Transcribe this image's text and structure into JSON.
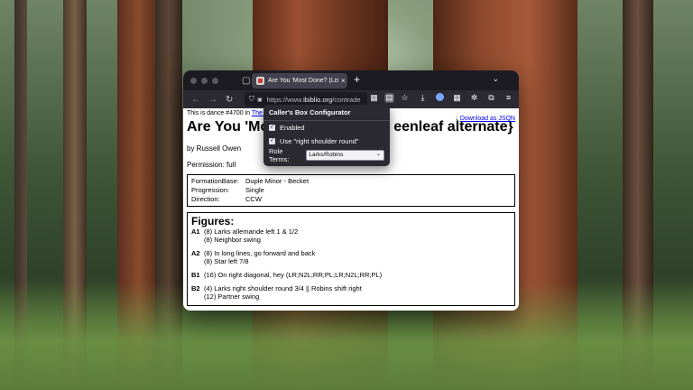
{
  "browser": {
    "tab_title": "Are You 'Most Done? (Lisa Gree",
    "tab_close": "×",
    "new_tab": "+",
    "tab_list": "⌄",
    "url_prefix": "https://www.",
    "url_domain": "ibiblio.org",
    "url_path": "/contrade",
    "icons": {
      "back": "←",
      "forward": "→",
      "reload": "↻",
      "shield": "⛉",
      "lock": "🔒",
      "bookmark": "☆",
      "download": "⤓",
      "extensions": "⧉",
      "menu": "≡"
    }
  },
  "page": {
    "intro_text": "This is dance #4700 in ",
    "intro_link": "The C",
    "download_arrow": "↓ ",
    "download_link": "Download as JSON",
    "title": "Are You 'Mo",
    "title_tail": "eenleaf alternate}",
    "byline": "by Russell Owen",
    "permission": "Permission: full",
    "meta": [
      {
        "k": "FormationBase:",
        "v": "Duple Minor - Becket"
      },
      {
        "k": "Progression:",
        "v": "Single"
      },
      {
        "k": "Direction:",
        "v": "CCW"
      }
    ],
    "figures_heading": "Figures:",
    "figures": [
      {
        "label": "A1",
        "lines": [
          "(8) Larks allemande left 1 & 1/2",
          "(8) Neighbor swing"
        ]
      },
      {
        "label": "A2",
        "lines": [
          "(8) In long lines, go forward and back",
          "(8) Star left 7/8"
        ]
      },
      {
        "label": "B1",
        "lines": [
          "(16) On right diagonal, hey (LR;N2L;RR;PL;LR;N2L;RR;PL)"
        ]
      },
      {
        "label": "B2",
        "lines": [
          "(4) Larks right shoulder round 3/4 || Robins shift right",
          "(12) Partner swing"
        ]
      }
    ]
  },
  "popup": {
    "title": "Caller's Box Configurator",
    "enabled_label": "Enabled",
    "rsr_label": "Use \"right shoulder round\"",
    "role_terms_label": "Role Terms:",
    "role_terms_value": "Larks/Robins",
    "check": "✓",
    "select_arrow": "⌄"
  }
}
